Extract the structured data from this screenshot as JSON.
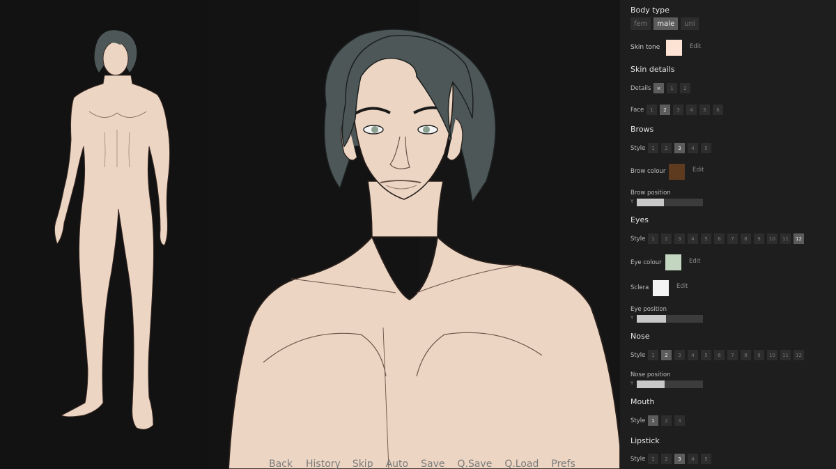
{
  "quick_menu": [
    "Back",
    "History",
    "Skip",
    "Auto",
    "Save",
    "Q.Save",
    "Q.Load",
    "Prefs"
  ],
  "settings": {
    "body_type": {
      "title": "Body type",
      "options": [
        "fem",
        "male",
        "uni"
      ],
      "selected": "male"
    },
    "skin_tone": {
      "label": "Skin tone",
      "color": "#fde3d3",
      "edit": "Edit"
    },
    "skin_details": {
      "title": "Skin details",
      "details": {
        "label": "Details",
        "options": [
          "×",
          "1",
          "2"
        ],
        "selected": "×"
      },
      "face": {
        "label": "Face",
        "options": [
          "1",
          "2",
          "3",
          "4",
          "5",
          "6"
        ],
        "selected": "2"
      }
    },
    "brows": {
      "title": "Brows",
      "style": {
        "label": "Style",
        "options": [
          "1",
          "2",
          "3",
          "4",
          "5"
        ],
        "selected": "3"
      },
      "colour": {
        "label": "Brow colour",
        "color": "#5e3a1e",
        "edit": "Edit"
      },
      "position": {
        "label": "Brow position",
        "axis": "Y",
        "value": 0.41
      }
    },
    "eyes": {
      "title": "Eyes",
      "style": {
        "label": "Style",
        "options": [
          "1",
          "2",
          "3",
          "4",
          "5",
          "6",
          "7",
          "8",
          "9",
          "10",
          "11",
          "12"
        ],
        "selected": "12"
      },
      "colour": {
        "label": "Eye colour",
        "color": "#c2d6c0",
        "edit": "Edit"
      },
      "sclera": {
        "label": "Sclera",
        "color": "#f4f4f4",
        "edit": "Edit"
      },
      "position": {
        "label": "Eye position",
        "axis": "Y",
        "value": 0.44
      }
    },
    "nose": {
      "title": "Nose",
      "style": {
        "label": "Style",
        "options": [
          "1",
          "2",
          "3",
          "4",
          "5",
          "6",
          "7",
          "8",
          "9",
          "10",
          "11",
          "12"
        ],
        "selected": "2"
      },
      "position": {
        "label": "Nose position",
        "axis": "Y",
        "value": 0.42
      }
    },
    "mouth": {
      "title": "Mouth",
      "style": {
        "label": "Style",
        "options": [
          "1",
          "2",
          "3"
        ],
        "selected": "1"
      }
    },
    "lipstick": {
      "title": "Lipstick",
      "style": {
        "label": "Style",
        "options": [
          "1",
          "2",
          "3",
          "4",
          "5"
        ],
        "selected": "3"
      }
    }
  },
  "colors": {
    "skin": "#ecd5c3",
    "hair": "#4d5757",
    "line": "#3a2a25",
    "panel": "#1e1e1e"
  }
}
